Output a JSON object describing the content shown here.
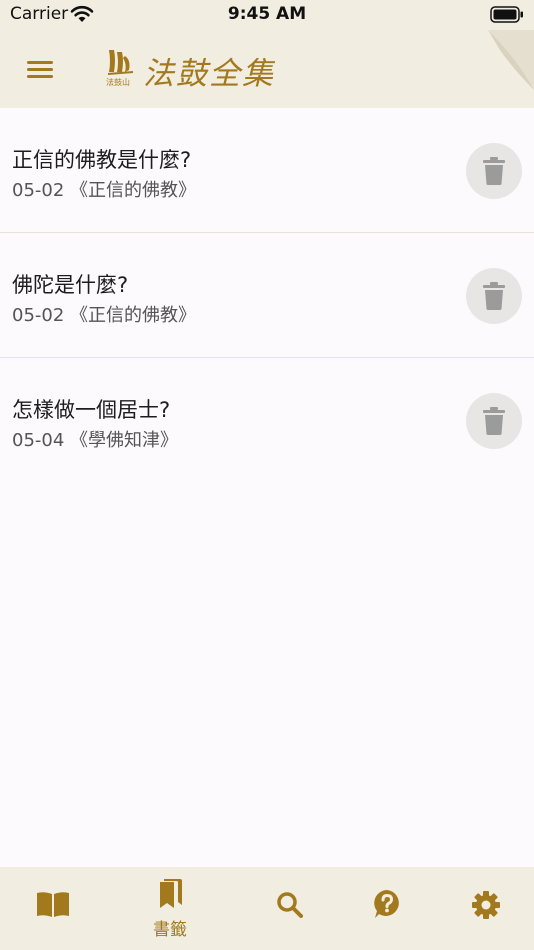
{
  "status_bar": {
    "carrier": "Carrier",
    "time": "9:45 AM"
  },
  "header": {
    "logo_text": "法鼓全集",
    "logo_small_text": "法鼓山",
    "menu_icon": "hamburger-icon"
  },
  "bookmarks": [
    {
      "title": "正信的佛教是什麼?",
      "subtitle": "05-02 《正信的佛教》"
    },
    {
      "title": "佛陀是什麼?",
      "subtitle": "05-02 《正信的佛教》"
    },
    {
      "title": "怎樣做一個居士?",
      "subtitle": "05-04 《學佛知津》"
    }
  ],
  "tab_bar": {
    "tabs": [
      {
        "icon": "book-open-icon",
        "label": ""
      },
      {
        "icon": "bookmark-icon",
        "label": "書籤",
        "selected": true
      },
      {
        "icon": "search-icon",
        "label": ""
      },
      {
        "icon": "help-icon",
        "label": ""
      },
      {
        "icon": "gear-icon",
        "label": ""
      }
    ]
  },
  "colors": {
    "accent": "#a2791d",
    "bar_background": "#f1ede0",
    "content_background": "#fdfafd",
    "delete_button_bg": "#e7e6e4",
    "trash_icon": "#9b9b9b"
  }
}
